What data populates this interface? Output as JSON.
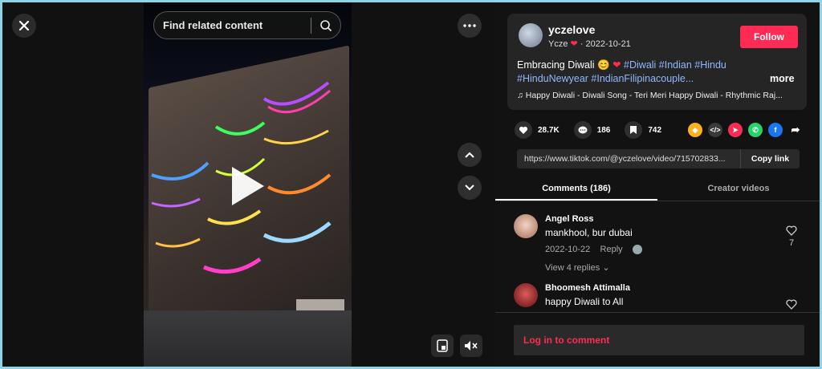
{
  "search": {
    "placeholder": "Find related content"
  },
  "post": {
    "username": "yczelove",
    "nickname": "Ycze",
    "date": "2022-10-21",
    "follow_label": "Follow",
    "caption_text": "Embracing Diwali",
    "hashtags_line1": "#Diwali #Indian #Hindu",
    "hashtags_line2": "#HinduNewyear #IndianFilipinacouple...",
    "more_label": "more",
    "music": "Happy Diwali - Diwali Song - Teri Meri Happy Diwali - Rhythmic Raj..."
  },
  "stats": {
    "likes": "28.7K",
    "comments": "186",
    "saves": "742"
  },
  "share_icons": [
    "cube-icon",
    "embed-icon",
    "send-icon",
    "whatsapp-icon",
    "facebook-icon",
    "forward-icon"
  ],
  "link": {
    "url": "https://www.tiktok.com/@yczelove/video/715702833...",
    "copy_label": "Copy link"
  },
  "tabs": [
    {
      "label": "Comments (186)"
    },
    {
      "label": "Creator videos"
    }
  ],
  "comments": [
    {
      "name": "Angel Ross",
      "text": "mankhool, bur dubai",
      "date": "2022-10-22",
      "reply_label": "Reply",
      "likes": "7",
      "replies_label": "View 4 replies"
    },
    {
      "name": "Bhoomesh Attimalla",
      "text": "happy Diwali to All"
    }
  ],
  "login_label": "Log in to comment",
  "colors": {
    "accent": "#fe2c55",
    "hashtag": "#8fb8ff",
    "panel": "#121212"
  }
}
